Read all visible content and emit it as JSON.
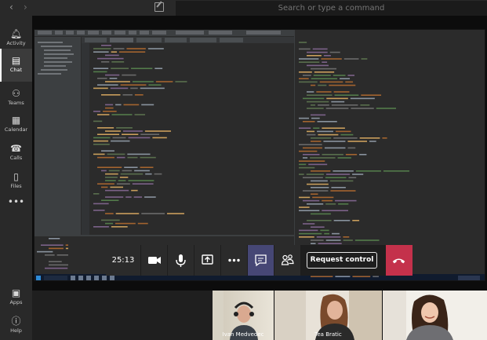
{
  "search": {
    "placeholder": "Search or type a command"
  },
  "rail": [
    {
      "label": "Activity",
      "icon": "bell-icon"
    },
    {
      "label": "Chat",
      "icon": "chat-icon",
      "active": true
    },
    {
      "label": "Teams",
      "icon": "teams-icon"
    },
    {
      "label": "Calendar",
      "icon": "calendar-icon"
    },
    {
      "label": "Calls",
      "icon": "phone-icon"
    },
    {
      "label": "Files",
      "icon": "file-icon"
    },
    {
      "label": "",
      "icon": "more-icon"
    },
    {
      "label": "Apps",
      "icon": "apps-icon"
    },
    {
      "label": "Help",
      "icon": "help-icon"
    }
  ],
  "call": {
    "duration": "25:13",
    "request_control_label": "Request control"
  },
  "participants": [
    {
      "name": "Ivan Medvedec"
    },
    {
      "name": "Tea Bratic"
    },
    {
      "name": ""
    }
  ],
  "colors": {
    "accent": "#464775",
    "hangup": "#c4314b",
    "rail_bg": "#292929"
  }
}
